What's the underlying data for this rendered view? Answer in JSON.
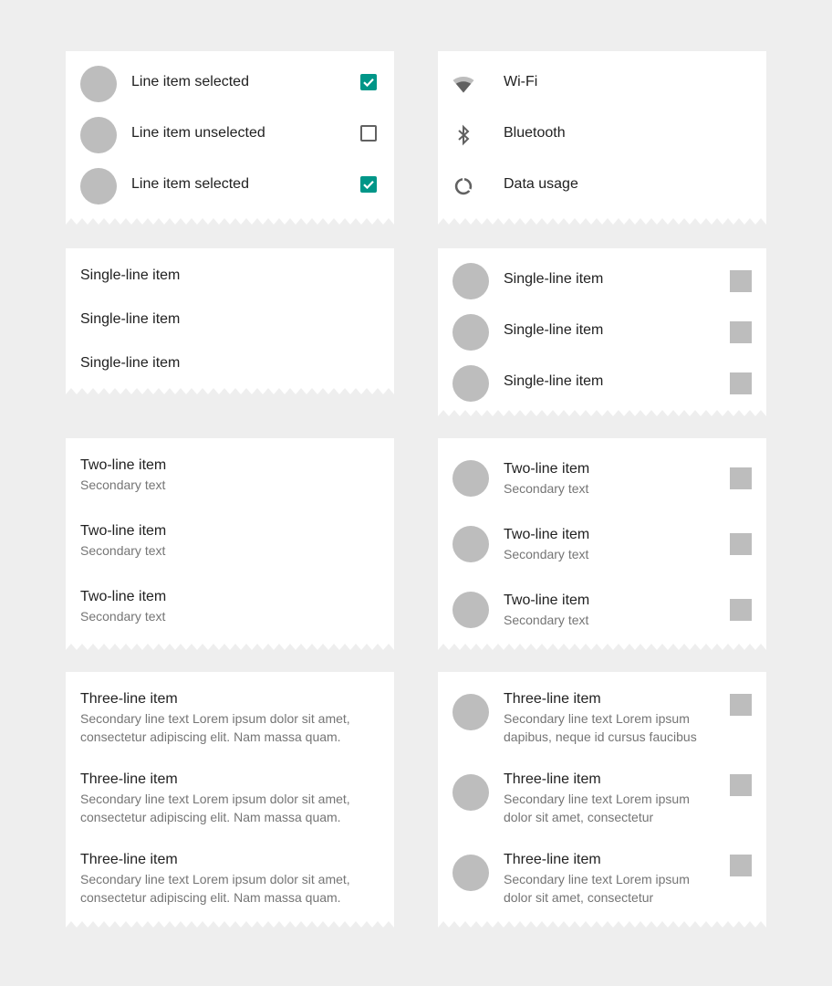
{
  "colors": {
    "accent": "#009688",
    "avatar": "#bdbdbd",
    "background": "#eeeeee"
  },
  "checkbox_list": [
    {
      "label": "Line item selected",
      "checked": true
    },
    {
      "label": "Line item unselected",
      "checked": false
    },
    {
      "label": "Line item selected",
      "checked": true
    }
  ],
  "settings_list": [
    {
      "icon": "wifi-icon",
      "label": "Wi-Fi"
    },
    {
      "icon": "bluetooth-icon",
      "label": "Bluetooth"
    },
    {
      "icon": "data-usage-icon",
      "label": "Data usage"
    }
  ],
  "single_line_list": [
    "Single-line item",
    "Single-line item",
    "Single-line item"
  ],
  "single_line_avatar_list": [
    "Single-line item",
    "Single-line item",
    "Single-line item"
  ],
  "two_line_list": [
    {
      "primary": "Two-line item",
      "secondary": "Secondary text"
    },
    {
      "primary": "Two-line item",
      "secondary": "Secondary text"
    },
    {
      "primary": "Two-line item",
      "secondary": "Secondary text"
    }
  ],
  "two_line_avatar_list": [
    {
      "primary": "Two-line item",
      "secondary": "Secondary text"
    },
    {
      "primary": "Two-line item",
      "secondary": "Secondary text"
    },
    {
      "primary": "Two-line item",
      "secondary": "Secondary text"
    }
  ],
  "three_line_list": [
    {
      "primary": "Three-line item",
      "secondary_1": "Secondary line text Lorem ipsum dolor sit amet,",
      "secondary_2": "consectetur adipiscing elit. Nam massa quam."
    },
    {
      "primary": "Three-line item",
      "secondary_1": "Secondary line text Lorem ipsum dolor sit amet,",
      "secondary_2": "consectetur adipiscing elit. Nam massa quam."
    },
    {
      "primary": "Three-line item",
      "secondary_1": "Secondary line text Lorem ipsum dolor sit amet,",
      "secondary_2": "consectetur adipiscing elit. Nam massa quam."
    }
  ],
  "three_line_avatar_list": [
    {
      "primary": "Three-line item",
      "secondary_1": "Secondary line text Lorem ipsum",
      "secondary_2": "dapibus, neque id cursus faucibus"
    },
    {
      "primary": "Three-line item",
      "secondary_1": "Secondary line text Lorem ipsum",
      "secondary_2": "dolor sit amet, consectetur"
    },
    {
      "primary": "Three-line item",
      "secondary_1": "Secondary line text Lorem ipsum",
      "secondary_2": "dolor sit amet, consectetur"
    }
  ]
}
